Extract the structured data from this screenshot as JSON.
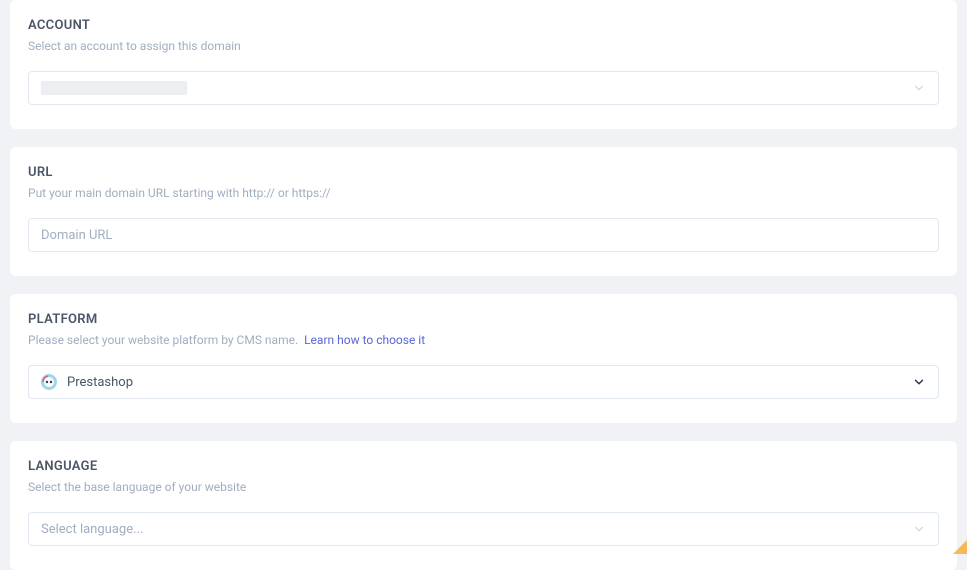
{
  "account": {
    "title": "ACCOUNT",
    "description": "Select an account to assign this domain"
  },
  "url": {
    "title": "URL",
    "description": "Put your main domain URL starting with http:// or https://",
    "placeholder": "Domain URL"
  },
  "platform": {
    "title": "PLATFORM",
    "description": "Please select your website platform by CMS name.",
    "link_text": "Learn how to choose it",
    "value": "Prestashop"
  },
  "language": {
    "title": "LANGUAGE",
    "description": "Select the base language of your website",
    "placeholder": "Select language..."
  }
}
